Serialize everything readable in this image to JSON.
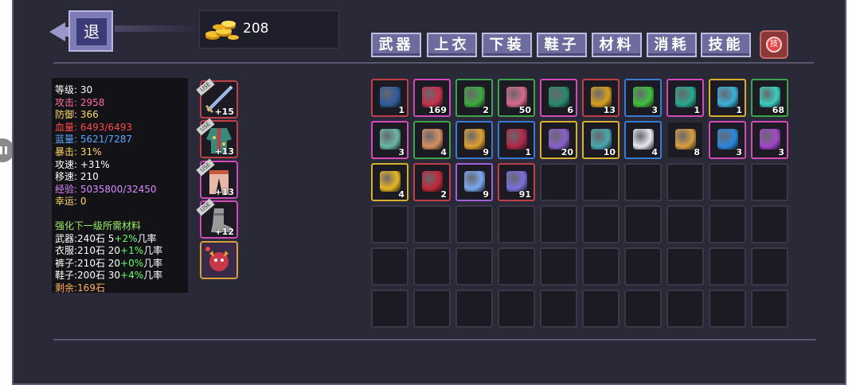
{
  "back_label": "退",
  "gold": "208",
  "tabs": [
    "武器",
    "上衣",
    "下装",
    "鞋子",
    "材料",
    "消耗",
    "技能"
  ],
  "settings_label": "技",
  "stats": {
    "level": {
      "label": "等级:",
      "value": "30",
      "color": "#ffffff"
    },
    "attack": {
      "label": "攻击:",
      "value": "2958",
      "color": "#ff6f9a"
    },
    "defense": {
      "label": "防御:",
      "value": "366",
      "color": "#ffd86a"
    },
    "hp": {
      "label": "血量:",
      "value": "6493/6493",
      "color": "#ff4b4b"
    },
    "mp": {
      "label": "蓝量:",
      "value": "5621/7287",
      "color": "#5aa8ff"
    },
    "crit": {
      "label": "暴击:",
      "value": "31%",
      "color": "#ffd86a"
    },
    "atk_speed": {
      "label": "攻速:",
      "value": "+31%",
      "color": "#ffffff"
    },
    "move_speed": {
      "label": "移速:",
      "value": "210",
      "color": "#ffffff"
    },
    "exp": {
      "label": "经验:",
      "value": "5035800/32450",
      "color": "#d88cff"
    },
    "luck": {
      "label": "幸运:",
      "value": "0",
      "color": "#ffd86a"
    }
  },
  "upgrade": {
    "title": "强化下一级所需材料",
    "weapon": {
      "label": "武器:240石 5",
      "rate": "+2%",
      "suffix": "几率"
    },
    "clothes": {
      "label": "衣服:210石 20",
      "rate": "+1%",
      "suffix": "几率"
    },
    "pants": {
      "label": "裤子:210石 20",
      "rate": "+0%",
      "suffix": "几率"
    },
    "shoes": {
      "label": "鞋子:200石 30",
      "rate": "+4%",
      "suffix": "几率"
    },
    "remaining": "剩余:169石"
  },
  "equipment": [
    {
      "name": "sword",
      "level": "+15",
      "use": "USE",
      "icon": "sword-icon"
    },
    {
      "name": "robe",
      "level": "+13",
      "use": "USE",
      "icon": "robe-icon"
    },
    {
      "name": "pants",
      "level": "+13",
      "use": "USE",
      "icon": "pants-icon"
    },
    {
      "name": "boots",
      "level": "+12",
      "use": "USE",
      "icon": "boots-icon"
    },
    {
      "name": "pet",
      "level": "",
      "use": "",
      "icon": "pet-icon"
    }
  ],
  "inventory": [
    {
      "count": "1",
      "border": "#c0404a",
      "color": "#2f5d9e",
      "icon": "spellbook-icon"
    },
    {
      "count": "169",
      "border": "#d04ab8",
      "color": "#c4324a",
      "icon": "red-crystal-icon"
    },
    {
      "count": "2",
      "border": "#3fa34d",
      "color": "#3faa3f",
      "icon": "slime-cube-icon"
    },
    {
      "count": "50",
      "border": "#3fa34d",
      "color": "#d86a8a",
      "icon": "pink-key-icon"
    },
    {
      "count": "6",
      "border": "#d04ab8",
      "color": "#2a8a6a",
      "icon": "green-key-icon"
    },
    {
      "count": "13",
      "border": "#c0404a",
      "color": "#d8a020",
      "icon": "gold-key-icon"
    },
    {
      "count": "3",
      "border": "#3a7ad0",
      "color": "#3fbf3f",
      "icon": "green-slime-icon"
    },
    {
      "count": "1",
      "border": "#d04ab8",
      "color": "#2aa890",
      "icon": "jade-dragon-icon"
    },
    {
      "count": "1",
      "border": "#d8b030",
      "color": "#3ab0d8",
      "icon": "compass-disc-icon"
    },
    {
      "count": "68",
      "border": "#3fa34d",
      "color": "#3acfc0",
      "icon": "crystal-burst-icon"
    },
    {
      "count": "3",
      "border": "#d04ab8",
      "color": "#6ab8a8",
      "icon": "potion-bottle-icon"
    },
    {
      "count": "4",
      "border": "#3fa34d",
      "color": "#d89060",
      "icon": "octopus-icon"
    },
    {
      "count": "9",
      "border": "#3a7ad0",
      "color": "#e0a030",
      "icon": "gem-amulet-icon"
    },
    {
      "count": "1",
      "border": "#3a7ad0",
      "color": "#b02848",
      "icon": "heart-icon"
    },
    {
      "count": "20",
      "border": "#d8b030",
      "color": "#8a60d0",
      "icon": "gem-cluster-icon"
    },
    {
      "count": "10",
      "border": "#d8b030",
      "color": "#4aa8b0",
      "icon": "rune-tablet-icon"
    },
    {
      "count": "4",
      "border": "#3a7ad0",
      "color": "#e8e8f0",
      "icon": "egg-icon"
    },
    {
      "count": "8",
      "border": "#2a2a34",
      "color": "#d8a040",
      "icon": "honeycomb-icon"
    },
    {
      "count": "3",
      "border": "#d04ab8",
      "color": "#2a88e0",
      "icon": "blue-orb-icon"
    },
    {
      "count": "3",
      "border": "#d04ab8",
      "color": "#a048c8",
      "icon": "purple-egg-icon"
    },
    {
      "count": "4",
      "border": "#d8b030",
      "color": "#e8b820",
      "icon": "gold-ore-icon"
    },
    {
      "count": "2",
      "border": "#c0404a",
      "color": "#c02838",
      "icon": "red-beast-icon"
    },
    {
      "count": "9",
      "border": "#a060d8",
      "color": "#7aa8f0",
      "icon": "ice-crystal-icon"
    },
    {
      "count": "91",
      "border": "#c0404a",
      "color": "#7a70d8",
      "icon": "gem-shards-icon"
    }
  ],
  "colors": {
    "panel": "#2a2938",
    "tab": "#6e6c9e",
    "upgrade_title": "#9ef06a",
    "rate_green": "#6aff6a",
    "upgrade_text": "#ffffff",
    "remaining": "#ffb060"
  }
}
